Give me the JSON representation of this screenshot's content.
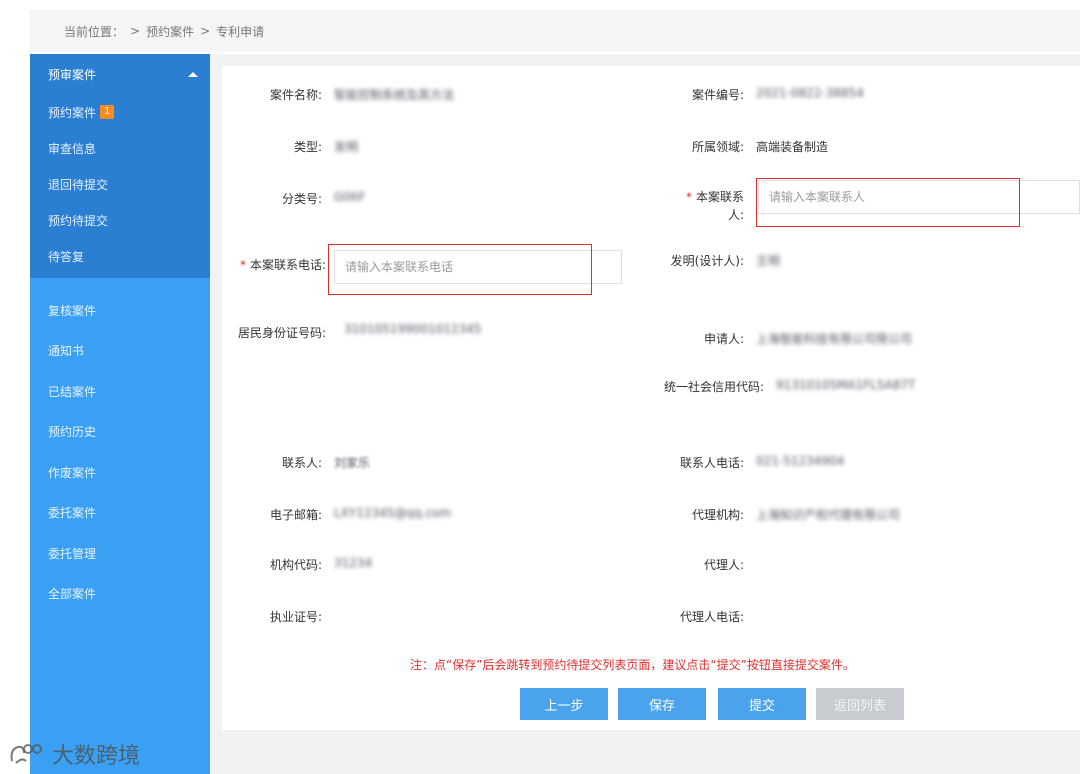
{
  "breadcrumb": {
    "items": [
      "当前位置：",
      ">",
      "预约案件",
      ">",
      "专利申请"
    ]
  },
  "sidebar": {
    "group_label": "预审案件",
    "sub_items": [
      {
        "label": "预约案件",
        "badge": "1"
      },
      {
        "label": "审查信息"
      },
      {
        "label": "退回待提交"
      },
      {
        "label": "预约待提交"
      },
      {
        "label": "待答复"
      }
    ],
    "items": [
      {
        "label": "复核案件"
      },
      {
        "label": "通知书"
      },
      {
        "label": "已结案件"
      },
      {
        "label": "预约历史"
      },
      {
        "label": "作废案件"
      },
      {
        "label": "委托案件"
      },
      {
        "label": "委托管理"
      },
      {
        "label": "全部案件"
      }
    ]
  },
  "form": {
    "case_name_label": "案件名称:",
    "case_name_value": "智能控制系统及其方法",
    "case_no_label": "案件编号:",
    "case_no_value": "2021-0822-38854",
    "type_label": "类型:",
    "type_value": "发明",
    "domain_label": "所属领域:",
    "domain_value": "高端装备制造",
    "class_label": "分类号:",
    "class_value": "G06F",
    "contact_label": "本案联系人:",
    "contact_label_line1": "本案联系",
    "contact_label_line2": "人:",
    "contact_placeholder": "请输入本案联系人",
    "phone_label": "本案联系电话:",
    "phone_placeholder": "请输入本案联系电话",
    "inventor_label": "发明(设计人):",
    "inventor_value": "王明",
    "id_label": "居民身份证号码:",
    "id_value": "310105199001012345",
    "applicant_label": "申请人:",
    "applicant_value": "上海智能科技有限公司限公司",
    "credit_label": "统一社会信用代码:",
    "credit_value": "91310105MA1FL5A87T",
    "person_label": "联系人:",
    "person_value": "刘家乐",
    "person_phone_label": "联系人电话:",
    "person_phone_value": "021-51234904",
    "email_label": "电子邮箱:",
    "email_value": "LXY12345@qq.com",
    "agency_label": "代理机构:",
    "agency_value": "上海知识产权代理有限公司",
    "org_code_label": "机构代码:",
    "org_code_value": "31234",
    "agent_label": "代理人:",
    "cert_label": "执业证号:",
    "agent_phone_label": "代理人电话:"
  },
  "note": "注：点“保存”后会跳转到预约待提交列表页面，建议点击“提交”按钮直接提交案件。",
  "buttons": {
    "prev": "上一步",
    "save": "保存",
    "submit": "提交",
    "back": "返回列表"
  },
  "watermark": {
    "text": "大数跨境"
  },
  "colors": {
    "sidebar": "#3aa0f3",
    "sidebar_active": "#2a7fd3",
    "button": "#4aa3ec",
    "required": "#e03030"
  }
}
